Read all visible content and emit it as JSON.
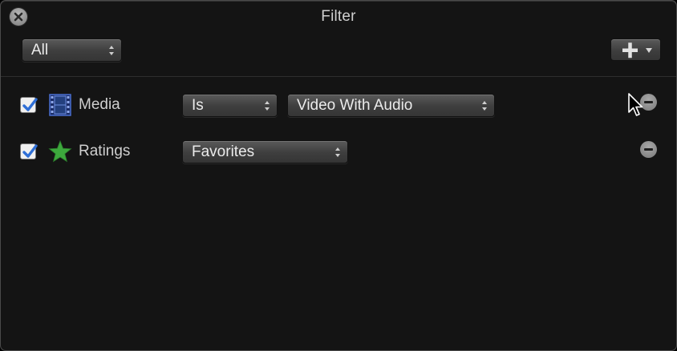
{
  "window": {
    "title": "Filter"
  },
  "toolbar": {
    "match_popup": "All"
  },
  "rules": [
    {
      "enabled": true,
      "icon": "film-strip-icon",
      "label": "Media",
      "operator": "Is",
      "value": "Video With Audio"
    },
    {
      "enabled": true,
      "icon": "star-icon",
      "label": "Ratings",
      "value": "Favorites"
    }
  ],
  "colors": {
    "background": "#141414",
    "checkbox_check": "#2f6fd6",
    "star": "#3da83d",
    "film": "#4a6fd0"
  }
}
